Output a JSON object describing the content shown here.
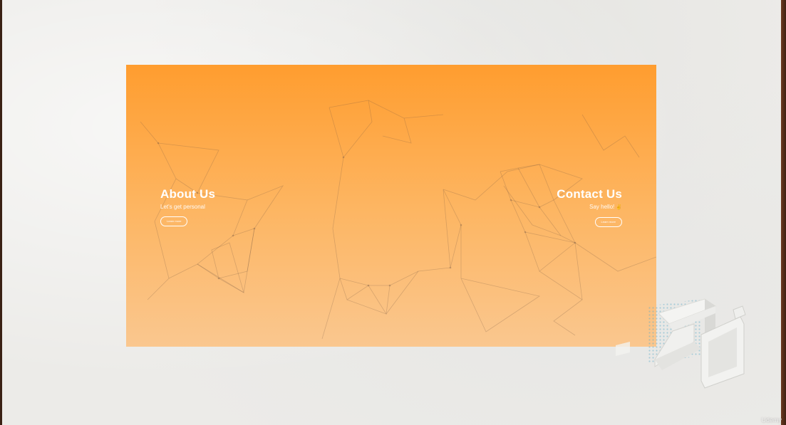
{
  "about": {
    "title": "About Us",
    "subtitle": "Let's get personal",
    "button_label": "Learn more"
  },
  "contact": {
    "title": "Contact Us",
    "subtitle": "Say hello!",
    "button_label": "Learn more",
    "emoji_icon": "sparkle-emoji-icon"
  },
  "watermark": {
    "text": "Udemy"
  },
  "colors": {
    "gradient_top": "#ff9d2f",
    "gradient_bottom": "#fac78f",
    "paper": "#ecebe8",
    "text": "#ffffff"
  }
}
